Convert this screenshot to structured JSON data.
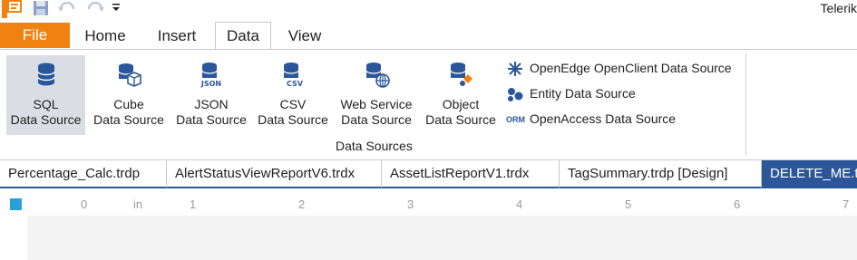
{
  "window": {
    "title_fragment": "Telerik"
  },
  "quick_access": {
    "app_icon": "report-designer-icon",
    "save_icon": "save-icon",
    "undo_icon": "undo-icon",
    "redo_icon": "redo-icon",
    "customize_icon": "customize-dropdown-icon"
  },
  "tabs": {
    "file": "File",
    "home": "Home",
    "insert": "Insert",
    "data": "Data",
    "view": "View"
  },
  "ribbon": {
    "group_label": "Data Sources",
    "buttons": [
      {
        "line1": "SQL",
        "line2": "Data Source",
        "icon": "database-icon"
      },
      {
        "line1": "Cube",
        "line2": "Data Source",
        "icon": "cube-database-icon"
      },
      {
        "line1": "JSON",
        "line2": "Data Source",
        "icon": "json-database-icon"
      },
      {
        "line1": "CSV",
        "line2": "Data Source",
        "icon": "csv-database-icon"
      },
      {
        "line1": "Web Service",
        "line2": "Data Source",
        "icon": "web-service-icon"
      },
      {
        "line1": "Object",
        "line2": "Data Source",
        "icon": "object-database-icon"
      }
    ],
    "small_buttons": [
      {
        "label": "OpenEdge OpenClient Data Source",
        "icon": "openedge-icon"
      },
      {
        "label": "Entity Data Source",
        "icon": "entity-icon"
      },
      {
        "label": "OpenAccess Data Source",
        "icon": "orm-icon",
        "icon_text": "ORM"
      }
    ],
    "colors": {
      "accent": "#2b579a",
      "file_tab": "#f0820f",
      "selected_button": "#dadde4"
    }
  },
  "doc_tabs": [
    "Percentage_Calc.trdp",
    "AlertStatusViewReportV6.trdx",
    "AssetListReportV1.trdx",
    "TagSummary.trdp [Design]",
    "DELETE_ME.trdp"
  ],
  "ruler": {
    "unit": "in",
    "labels": [
      "0",
      "1",
      "2",
      "3",
      "4",
      "5",
      "6",
      "7"
    ]
  }
}
